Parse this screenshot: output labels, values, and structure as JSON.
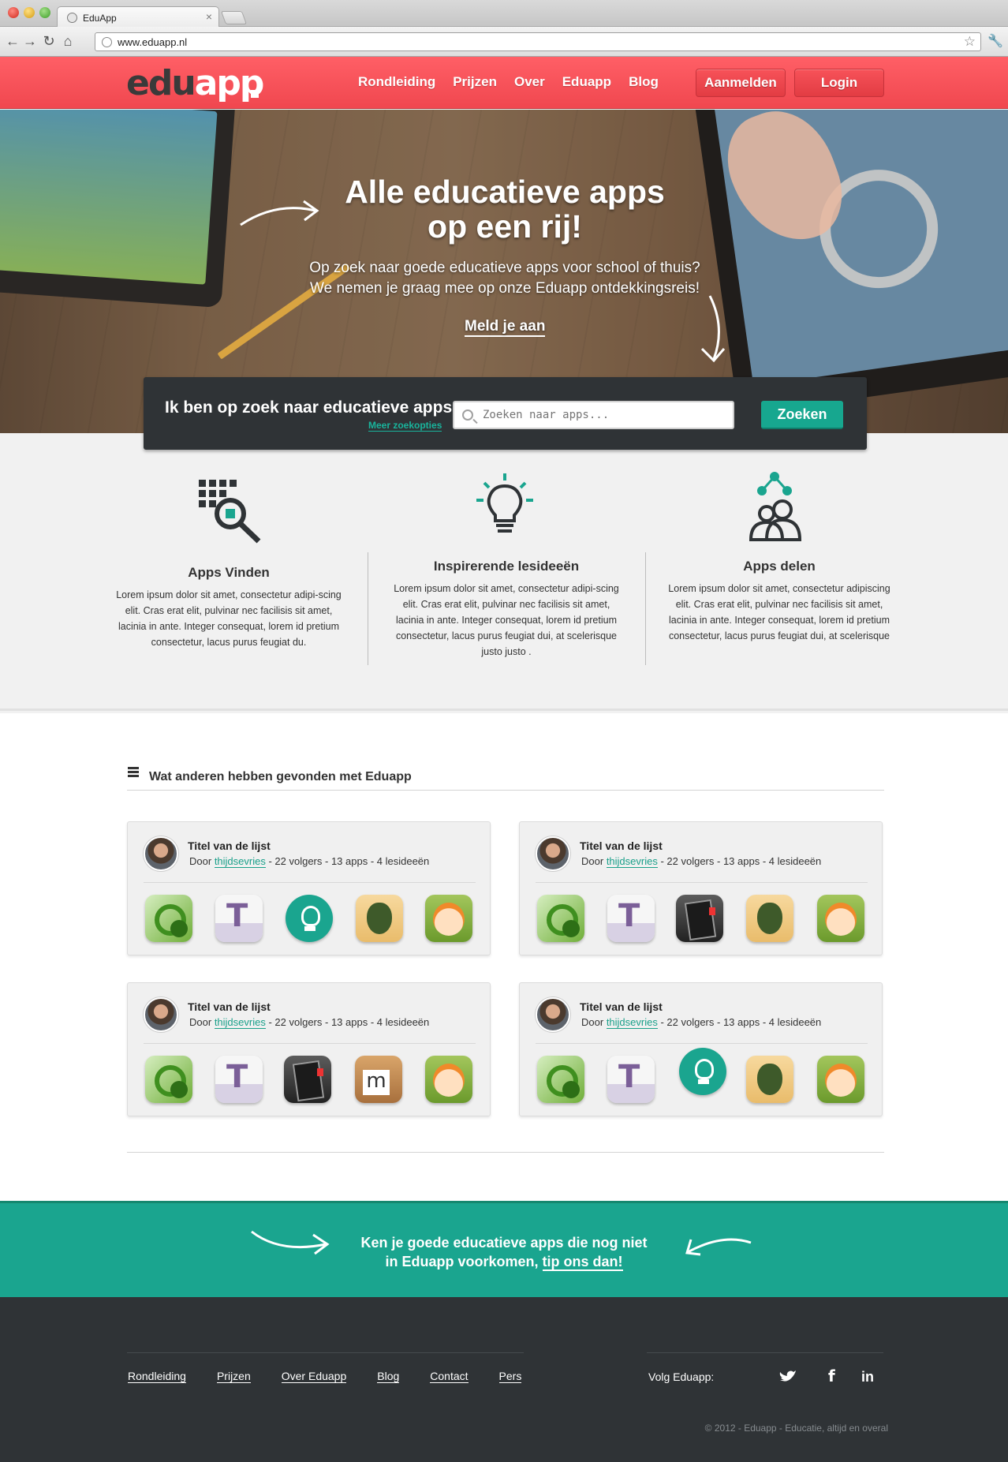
{
  "browser": {
    "tab_title": "EduApp",
    "url": "www.eduapp.nl"
  },
  "header": {
    "logo_left": "edu",
    "logo_right": "app",
    "nav": [
      "Rondleiding",
      "Prijzen",
      "Over",
      "Eduapp",
      "Blog"
    ],
    "signup_label": "Aanmelden",
    "login_label": "Login"
  },
  "hero": {
    "title_line1": "Alle educatieve apps",
    "title_line2": "op een rij!",
    "subtitle_line1": "Op zoek naar goede educatieve apps voor school of thuis?",
    "subtitle_line2": "We nemen je graag mee op onze Eduapp ontdekkingsreis!",
    "cta": "Meld je aan"
  },
  "search": {
    "heading": "Ik ben op zoek naar educatieve apps",
    "more_options": "Meer zoekopties",
    "placeholder": "Zoeken naar apps...",
    "button": "Zoeken"
  },
  "features": [
    {
      "title": "Apps Vinden",
      "text": "Lorem ipsum dolor sit amet, consectetur adipi-scing elit. Cras erat elit, pulvinar nec facilisis sit amet, lacinia in ante. Integer consequat, lorem id pretium consectetur, lacus purus feugiat du."
    },
    {
      "title": "Inspirerende lesideeën",
      "text": "Lorem ipsum dolor sit amet, consectetur adipi-scing elit. Cras erat elit, pulvinar nec facilisis sit amet, lacinia in ante. Integer consequat, lorem id pretium consectetur, lacus purus feugiat dui, at scelerisque justo justo ."
    },
    {
      "title": "Apps delen",
      "text": "Lorem ipsum dolor sit amet, consectetur adipiscing elit. Cras erat elit, pulvinar nec facilisis sit amet, lacinia in ante. Integer consequat, lorem id pretium consectetur, lacus purus feugiat dui, at scelerisque"
    }
  ],
  "lists": {
    "heading": "Wat anderen hebben gevonden met Eduapp",
    "cards": [
      {
        "title": "Titel van de lijst",
        "by_prefix": "Door",
        "author": "thijdsevries",
        "stats": "- 22 volgers - 13 apps - 4 lesideeën",
        "apps": [
          "globe-app-icon",
          "t-app-icon",
          "lightbulb-app-icon",
          "owl-app-icon",
          "kid-app-icon"
        ]
      },
      {
        "title": "Titel van de lijst",
        "by_prefix": "Door",
        "author": "thijdsevries",
        "stats": "- 22 volgers - 13 apps - 4 lesideeën",
        "apps": [
          "globe-app-icon",
          "t-app-icon",
          "book-app-icon",
          "owl-app-icon",
          "kid-app-icon"
        ]
      },
      {
        "title": "Titel van de lijst",
        "by_prefix": "Door",
        "author": "thijdsevries",
        "stats": "- 22 volgers - 13 apps - 4 lesideeën",
        "apps": [
          "globe-app-icon",
          "t-app-icon",
          "book-app-icon",
          "m-app-icon",
          "kid-app-icon"
        ]
      },
      {
        "title": "Titel van de lijst",
        "by_prefix": "Door",
        "author": "thijdsevries",
        "stats": "- 22 volgers - 13 apps - 4 lesideeën",
        "apps": [
          "globe-app-icon",
          "t-app-icon",
          "lightbulb-app-icon",
          "owl-app-icon",
          "kid-app-icon"
        ]
      }
    ]
  },
  "tip": {
    "line1": "Ken je goede educatieve apps die nog niet",
    "line2_prefix": "in Eduapp voorkomen,",
    "link": "tip ons dan!"
  },
  "footer": {
    "nav": [
      "Rondleiding",
      "Prijzen",
      "Over Eduapp",
      "Blog",
      "Contact",
      "Pers"
    ],
    "follow": "Volg Eduapp:",
    "social_icons": [
      "twitter-icon",
      "facebook-icon",
      "linkedin-icon"
    ],
    "copyright": "© 2012 - Eduapp - Educatie, altijd en overal"
  },
  "colors": {
    "brand_red": "#f0474f",
    "brand_teal": "#1aa58f",
    "dark": "#2f3336"
  }
}
